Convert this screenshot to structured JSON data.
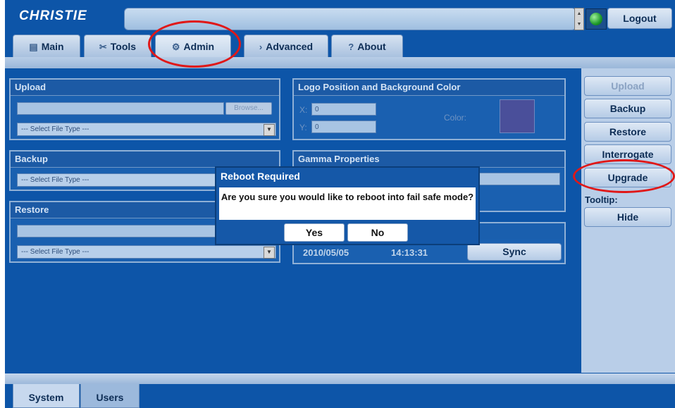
{
  "app": {
    "logo": "CHRISTIE",
    "logout_label": "Logout",
    "status_text": ""
  },
  "tabs": [
    {
      "label": "Main",
      "icon": "monitor-icon"
    },
    {
      "label": "Tools",
      "icon": "tools-icon"
    },
    {
      "label": "Admin",
      "icon": "gear-icon"
    },
    {
      "label": "Advanced",
      "icon": "arrow-icon"
    },
    {
      "label": "About",
      "icon": "question-icon"
    }
  ],
  "upload": {
    "title": "Upload",
    "browse_label": "Browse...",
    "file_path": "",
    "file_type": "--- Select File Type ---"
  },
  "backup": {
    "title": "Backup",
    "file_type": "--- Select File Type ---"
  },
  "restore": {
    "title": "Restore",
    "file_path": "",
    "file_type": "--- Select File Type ---"
  },
  "logo_position": {
    "title": "Logo Position and Background Color",
    "x_label": "X:",
    "x_value": "0",
    "y_label": "Y:",
    "y_value": "0",
    "color_label": "Color:",
    "color_value": "#4a4f9a"
  },
  "gamma": {
    "title": "Gamma Properties"
  },
  "datetime": {
    "date": "2010/05/05",
    "time": "14:13:31",
    "sync_label": "Sync"
  },
  "sidebar": {
    "upload_label": "Upload",
    "backup_label": "Backup",
    "restore_label": "Restore",
    "interrogate_label": "Interrogate",
    "upgrade_label": "Upgrade",
    "tooltip_label": "Tooltip:",
    "hide_label": "Hide"
  },
  "bottom_tabs": [
    {
      "label": "System"
    },
    {
      "label": "Users"
    }
  ],
  "dialog": {
    "title": "Reboot Required",
    "message": "Are you sure you would like to reboot into fail safe mode?",
    "yes_label": "Yes",
    "no_label": "No"
  },
  "colors": {
    "primary": "#0d55a8",
    "sidebar": "#b9cee8",
    "highlight": "#e01818"
  }
}
